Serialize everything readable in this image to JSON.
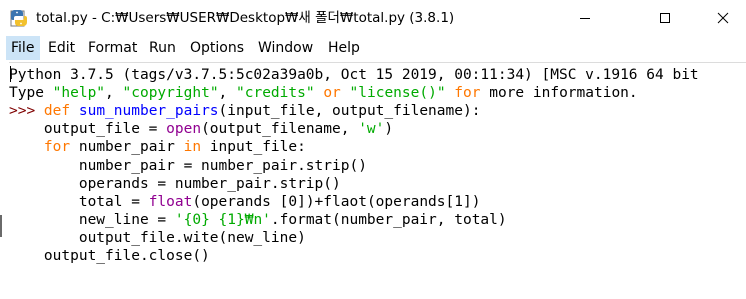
{
  "window": {
    "title": "total.py - C:₩Users₩USER₩Desktop₩새 폴더₩total.py (3.8.1)",
    "icon": "python-idle-icon",
    "buttons": {
      "minimize": "minimize-icon",
      "maximize": "maximize-icon",
      "close": "close-icon"
    }
  },
  "menubar": {
    "items": [
      {
        "label": "File",
        "active": true
      },
      {
        "label": "Edit"
      },
      {
        "label": "Format"
      },
      {
        "label": "Run"
      },
      {
        "label": "Options"
      },
      {
        "label": "Window"
      },
      {
        "label": "Help"
      }
    ]
  },
  "colors": {
    "keyword": "#ff7700",
    "string": "#00aa00",
    "definition": "#0000ff",
    "builtin": "#900090",
    "prompt": "#7f0000",
    "menu_highlight": "#cce4f7"
  },
  "editor": {
    "lines": [
      [
        {
          "t": "Python 3.7.5 (tags/v3.7.5:5c02a39a0b, Oct 15 2019, 00:11:34) [MSC v.1916 64 bit",
          "c": "fg"
        }
      ],
      [
        {
          "t": "Type ",
          "c": "fg"
        },
        {
          "t": "\"help\"",
          "c": "str"
        },
        {
          "t": ", ",
          "c": "fg"
        },
        {
          "t": "\"copyright\"",
          "c": "str"
        },
        {
          "t": ", ",
          "c": "fg"
        },
        {
          "t": "\"credits\"",
          "c": "str"
        },
        {
          "t": " ",
          "c": "fg"
        },
        {
          "t": "or",
          "c": "kw"
        },
        {
          "t": " ",
          "c": "fg"
        },
        {
          "t": "\"license()\"",
          "c": "str"
        },
        {
          "t": " ",
          "c": "fg"
        },
        {
          "t": "for",
          "c": "kw"
        },
        {
          "t": " more information.",
          "c": "fg"
        }
      ],
      [
        {
          "t": ">>> ",
          "c": "prompt"
        },
        {
          "t": "def",
          "c": "kw"
        },
        {
          "t": " ",
          "c": "fg"
        },
        {
          "t": "sum_number_pairs",
          "c": "def"
        },
        {
          "t": "(input_file, output_filename):",
          "c": "fg"
        }
      ],
      [
        {
          "t": "    output_file = ",
          "c": "fg"
        },
        {
          "t": "open",
          "c": "bi"
        },
        {
          "t": "(output_filename, ",
          "c": "fg"
        },
        {
          "t": "'w'",
          "c": "str"
        },
        {
          "t": ")",
          "c": "fg"
        }
      ],
      [
        {
          "t": "    ",
          "c": "fg"
        },
        {
          "t": "for",
          "c": "kw"
        },
        {
          "t": " number_pair ",
          "c": "fg"
        },
        {
          "t": "in",
          "c": "kw"
        },
        {
          "t": " input_file:",
          "c": "fg"
        }
      ],
      [
        {
          "t": "        number_pair = number_pair.strip()",
          "c": "fg"
        }
      ],
      [
        {
          "t": "        operands = number_pair.strip()",
          "c": "fg"
        }
      ],
      [
        {
          "t": "        total = ",
          "c": "fg"
        },
        {
          "t": "float",
          "c": "bi"
        },
        {
          "t": "(operands [0])+flaot(operands[1])",
          "c": "fg"
        }
      ],
      [
        {
          "t": "        new_line = ",
          "c": "fg"
        },
        {
          "t": "'{0} {1}₩n'",
          "c": "str"
        },
        {
          "t": ".format(number_pair, total)",
          "c": "fg"
        }
      ],
      [
        {
          "t": "        output_file.wite(new_line)",
          "c": "fg"
        }
      ],
      [
        {
          "t": "    output_file.close()",
          "c": "fg"
        }
      ]
    ]
  }
}
